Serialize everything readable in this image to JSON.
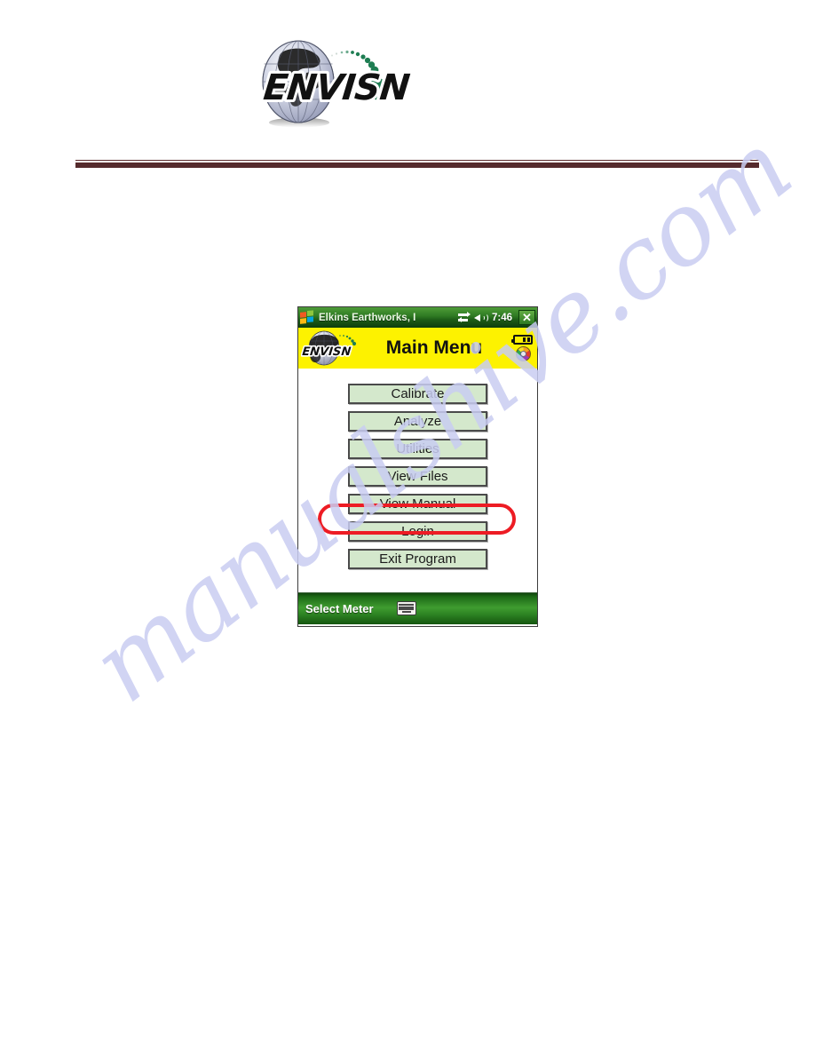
{
  "page": {
    "background_color": "#ffffff",
    "watermark_text": "manualshive.com",
    "watermark_color": "#c9cdf2"
  },
  "brand_logo": {
    "wordmark": "ENVISION",
    "alt": "Envision globe logo",
    "globe_color": "#b9bdd4",
    "accent_color": "#16794a"
  },
  "divider": {
    "color": "#552a2c"
  },
  "device": {
    "titlebar": {
      "app_title": "Elkins Earthworks, I",
      "time": "7:46",
      "close_label": "✕",
      "icons": [
        "windows-flag-icon",
        "connectivity-icon",
        "speaker-icon"
      ],
      "background_color": "#2f7b23"
    },
    "header": {
      "title": "Main Menu",
      "background_color": "#fdf200",
      "logo_wordmark": "ENVISION",
      "icons": [
        "battery-icon",
        "compass-icon"
      ]
    },
    "menu": {
      "buttons": [
        {
          "label": "Calibrate",
          "highlighted": false
        },
        {
          "label": "Analyze",
          "highlighted": false
        },
        {
          "label": "Utilities",
          "highlighted": true
        },
        {
          "label": "View Files",
          "highlighted": false
        },
        {
          "label": "View Manual",
          "highlighted": false
        },
        {
          "label": "Login",
          "highlighted": false
        },
        {
          "label": "Exit Program",
          "highlighted": false
        }
      ],
      "button_fill": "#d4e8cc",
      "button_border": "#4a4a4a",
      "highlight_color": "#ed1c24"
    },
    "softkeys": {
      "left_label": "Select Meter",
      "right_icon": "keyboard-icon",
      "background_color": "#3f9c30"
    }
  }
}
